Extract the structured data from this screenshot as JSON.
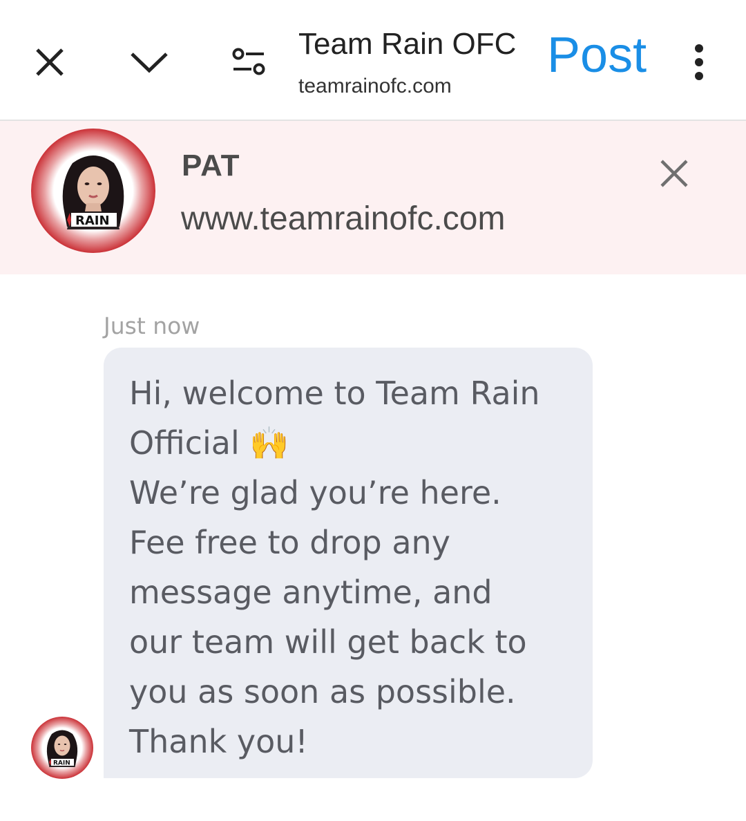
{
  "topbar": {
    "title": "Team Rain OFC",
    "domain": "teamrainofc.com",
    "post_label": "Post",
    "icons": [
      "close-icon",
      "chevron-down-icon",
      "tune-icon",
      "more-vert-icon"
    ]
  },
  "chat": {
    "agent_name": "PAT",
    "agent_site": "www.teamrainofc.com",
    "logo_text": "RAIN",
    "message": {
      "timestamp": "Just now",
      "lines": [
        "Hi, welcome to Team Rain",
        "Official 🙌",
        "We’re glad you’re here.",
        "Fee free to drop any",
        "message anytime, and",
        "our team will get back to",
        "you as soon as possible.",
        "Thank you!"
      ]
    }
  },
  "colors": {
    "accent": "#1a8ee6",
    "header_bg": "#fdf1f2",
    "bubble_bg": "#ebedf3",
    "avatar_ring": "#c8282e"
  }
}
